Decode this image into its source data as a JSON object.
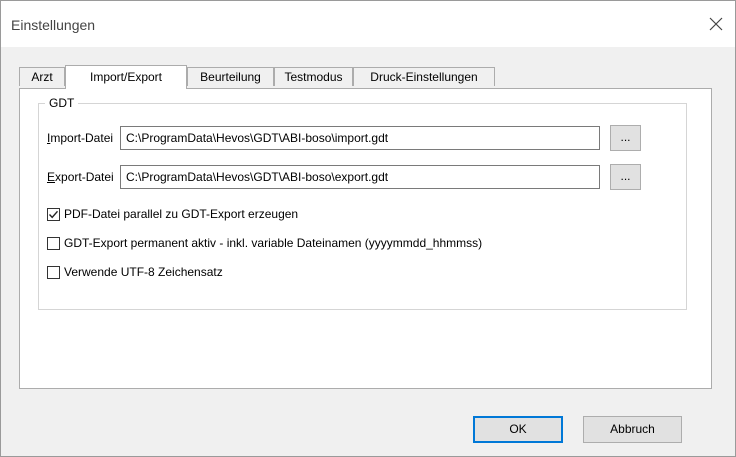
{
  "window": {
    "title": "Einstellungen"
  },
  "tabs": [
    {
      "label": "Arzt"
    },
    {
      "label": "Import/Export"
    },
    {
      "label": "Beurteilung"
    },
    {
      "label": "Testmodus"
    },
    {
      "label": "Druck-Einstellungen"
    }
  ],
  "active_tab": "Import/Export",
  "gdt": {
    "group_label": "GDT",
    "import": {
      "label_mnemonic": "I",
      "label_rest": "mport-Datei",
      "value": "C:\\ProgramData\\Hevos\\GDT\\ABI-boso\\import.gdt",
      "browse_label": "..."
    },
    "export": {
      "label_mnemonic": "E",
      "label_rest": "xport-Datei",
      "value": "C:\\ProgramData\\Hevos\\GDT\\ABI-boso\\export.gdt",
      "browse_label": "..."
    },
    "options": [
      {
        "label": "PDF-Datei parallel zu GDT-Export erzeugen",
        "checked": true
      },
      {
        "label": "GDT-Export permanent aktiv - inkl. variable Dateinamen (yyyymmdd_hhmmss)",
        "checked": false
      },
      {
        "label": "Verwende UTF-8 Zeichensatz",
        "checked": false
      }
    ]
  },
  "buttons": {
    "ok": "OK",
    "cancel": "Abbruch"
  },
  "icons": {
    "close": "close-icon",
    "check": "checkmark-icon"
  },
  "colors": {
    "default_button_border": "#0078d7",
    "dialog_background": "#f0f0f0"
  }
}
